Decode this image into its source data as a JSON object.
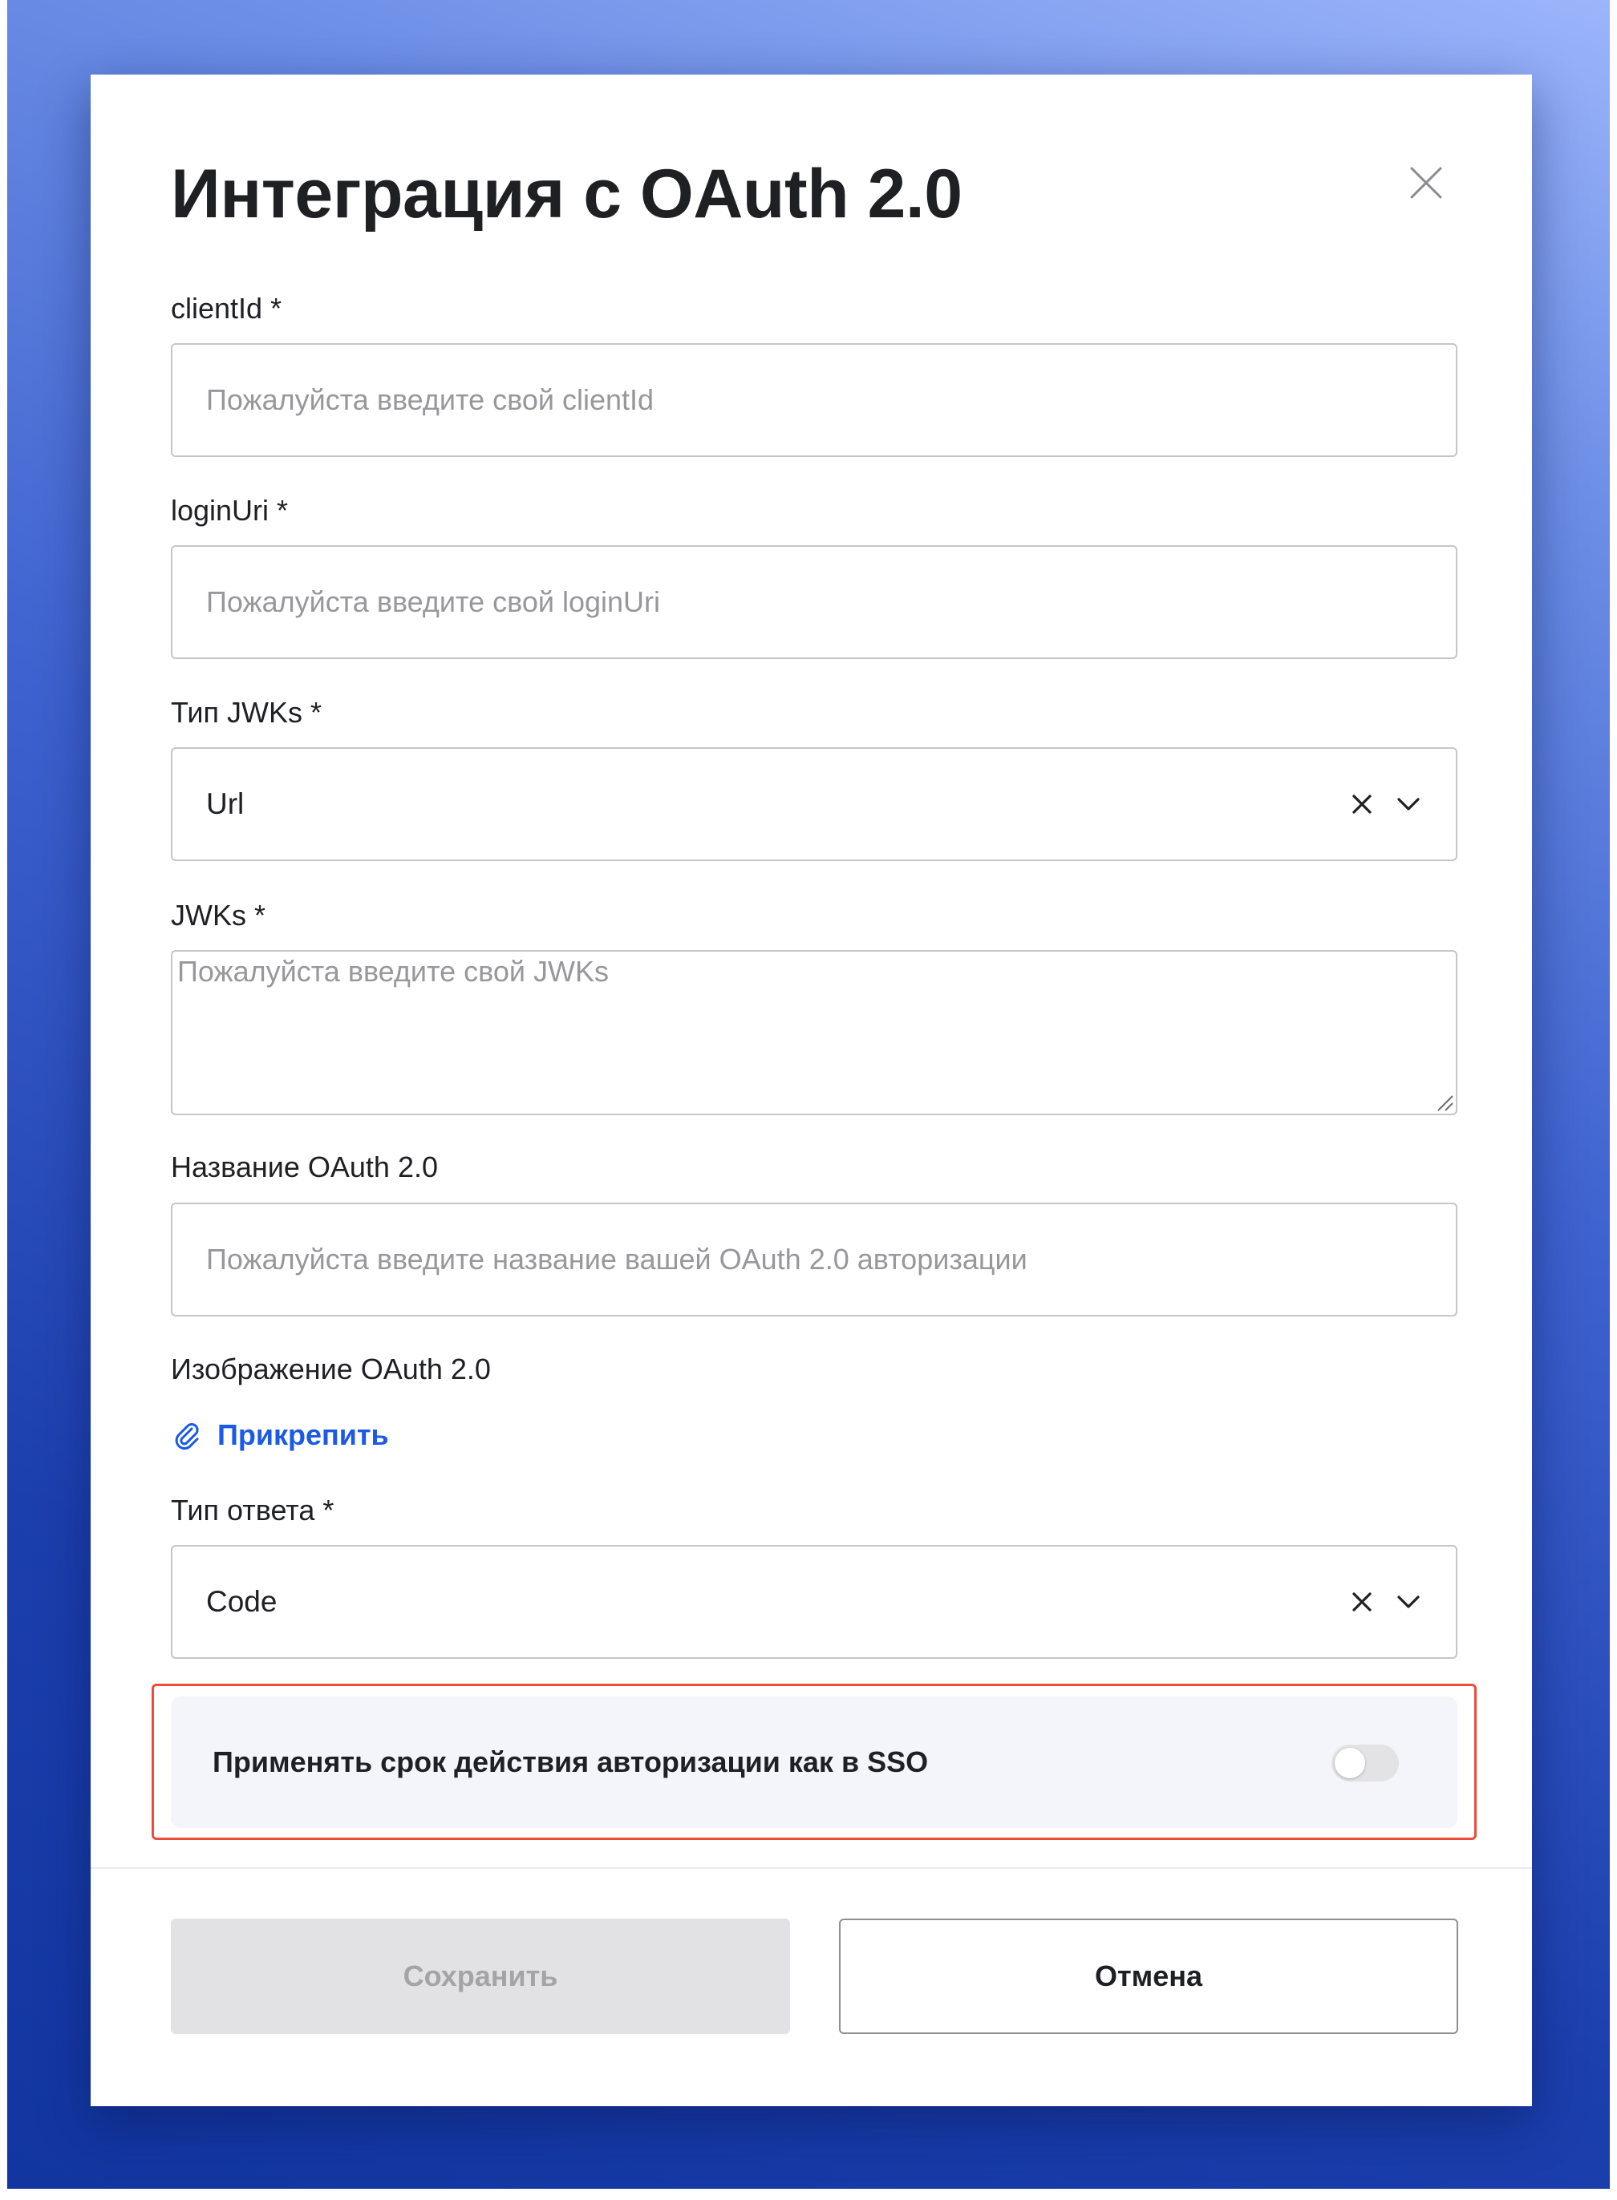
{
  "dialog": {
    "title": "Интеграция с OAuth 2.0",
    "close_icon": "close-icon"
  },
  "fields": {
    "client_id": {
      "label": "clientId *",
      "placeholder": "Пожалуйста введите свой clientId",
      "value": ""
    },
    "login_uri": {
      "label": "loginUri *",
      "placeholder": "Пожалуйста введите свой loginUri",
      "value": ""
    },
    "jwks_type": {
      "label": "Тип JWKs *",
      "value": "Url",
      "clear_icon": "clear-x-icon",
      "dropdown_icon": "chevron-down-icon"
    },
    "jwks": {
      "label": "JWKs *",
      "placeholder": "Пожалуйста введите свой JWKs",
      "value": ""
    },
    "oauth_name": {
      "label": "Название OAuth 2.0",
      "placeholder": "Пожалуйста введите название вашей OAuth 2.0 авторизации",
      "value": ""
    },
    "oauth_image": {
      "label": "Изображение OAuth 2.0",
      "attach_label": "Прикрепить",
      "attach_icon": "paperclip-icon"
    },
    "response_type": {
      "label": "Тип ответа *",
      "value": "Code",
      "clear_icon": "clear-x-icon",
      "dropdown_icon": "chevron-down-icon"
    }
  },
  "sso_option": {
    "label": "Применять срок действия авторизации как в SSO",
    "enabled": false
  },
  "footer": {
    "save_label": "Сохранить",
    "save_disabled": true,
    "cancel_label": "Отмена"
  },
  "colors": {
    "accent_link": "#1a5ae6",
    "highlight_border": "#ef4b3c",
    "text_primary": "#1f2024",
    "placeholder": "#97979c",
    "backdrop_top": "#9cb5fb",
    "backdrop_bottom": "#12359f"
  }
}
